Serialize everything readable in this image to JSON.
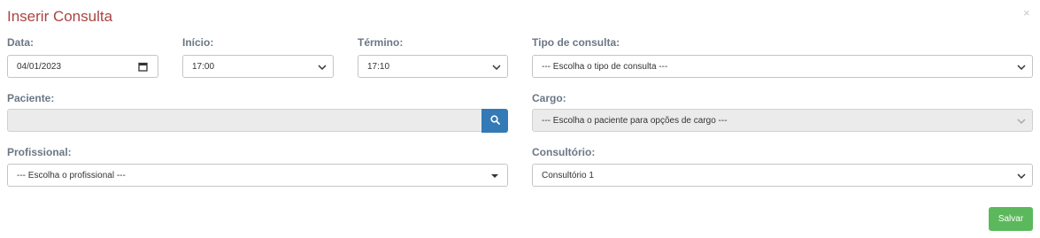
{
  "modal": {
    "title": "Inserir Consulta",
    "close_glyph": "×"
  },
  "form": {
    "data": {
      "label": "Data:",
      "value": "04/01/2023",
      "icon": "calendar-icon"
    },
    "inicio": {
      "label": "Início:",
      "value": "17:00"
    },
    "termino": {
      "label": "Término:",
      "value": "17:10"
    },
    "tipo_consulta": {
      "label": "Tipo de consulta:",
      "value": "--- Escolha o tipo de consulta ---"
    },
    "paciente": {
      "label": "Paciente:",
      "value": "",
      "search_icon": "search-icon"
    },
    "cargo": {
      "label": "Cargo:",
      "value": "--- Escolha o paciente para opções de cargo ---"
    },
    "profissional": {
      "label": "Profissional:",
      "value": "--- Escolha o profissional ---"
    },
    "consultorio": {
      "label": "Consultório:",
      "value": "Consultório 1"
    }
  },
  "footer": {
    "save_label": "Salvar"
  },
  "colors": {
    "title": "#a94442",
    "label": "#6b7785",
    "primary_button": "#337ab7",
    "success_button": "#5cb85c",
    "disabled_field": "#ebebeb"
  }
}
